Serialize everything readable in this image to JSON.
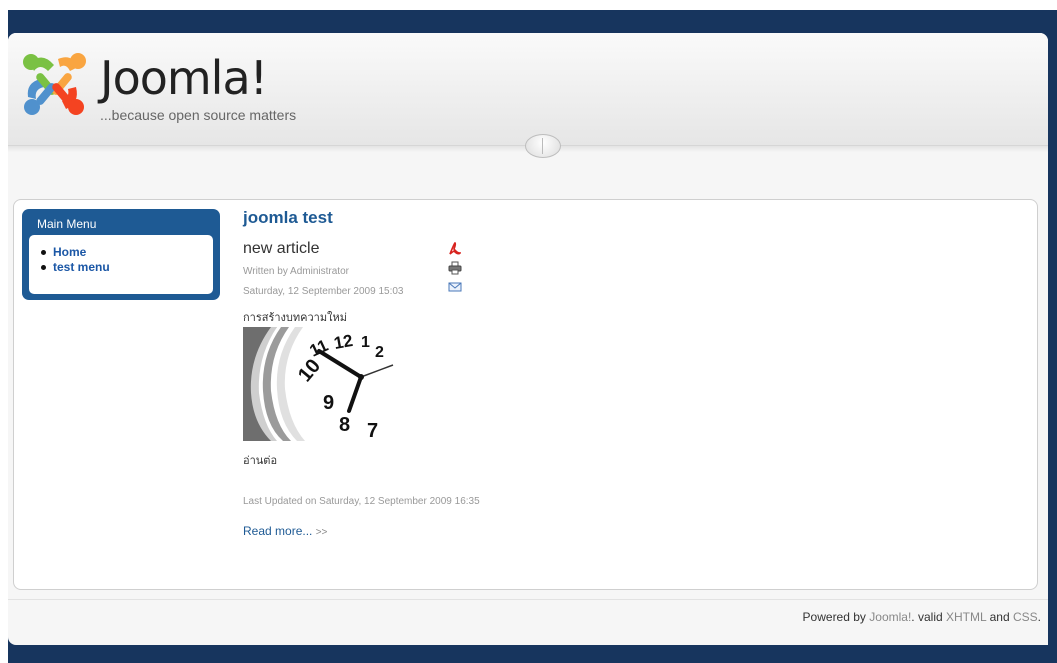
{
  "header": {
    "logo_text": "Joomla!",
    "tagline": "...because open source matters"
  },
  "main_menu": {
    "title": "Main Menu",
    "items": [
      {
        "label": "Home"
      },
      {
        "label": "test menu"
      }
    ]
  },
  "content": {
    "category_title": "joomla test",
    "article": {
      "title": "new article",
      "icons": [
        "pdf-icon",
        "print-icon",
        "email-icon"
      ],
      "written_by": "Written by Administrator",
      "date": "Saturday, 12 September 2009 15:03",
      "body_text": "การสร้างบทความใหม่",
      "image": "clock-image",
      "read_text": "อ่านต่อ",
      "last_updated": "Last Updated on Saturday, 12 September 2009 16:35",
      "read_more": "Read more...",
      "read_more_arrow": ">>"
    }
  },
  "footer": {
    "powered_by": "Powered by",
    "joomla_link": "Joomla!",
    "valid": "valid",
    "xhtml_link": "XHTML",
    "and": "and",
    "css_link": "CSS",
    "period": "."
  },
  "colors": {
    "frame": "#17355e",
    "accent": "#1e5a94",
    "link": "#1b57a6"
  }
}
